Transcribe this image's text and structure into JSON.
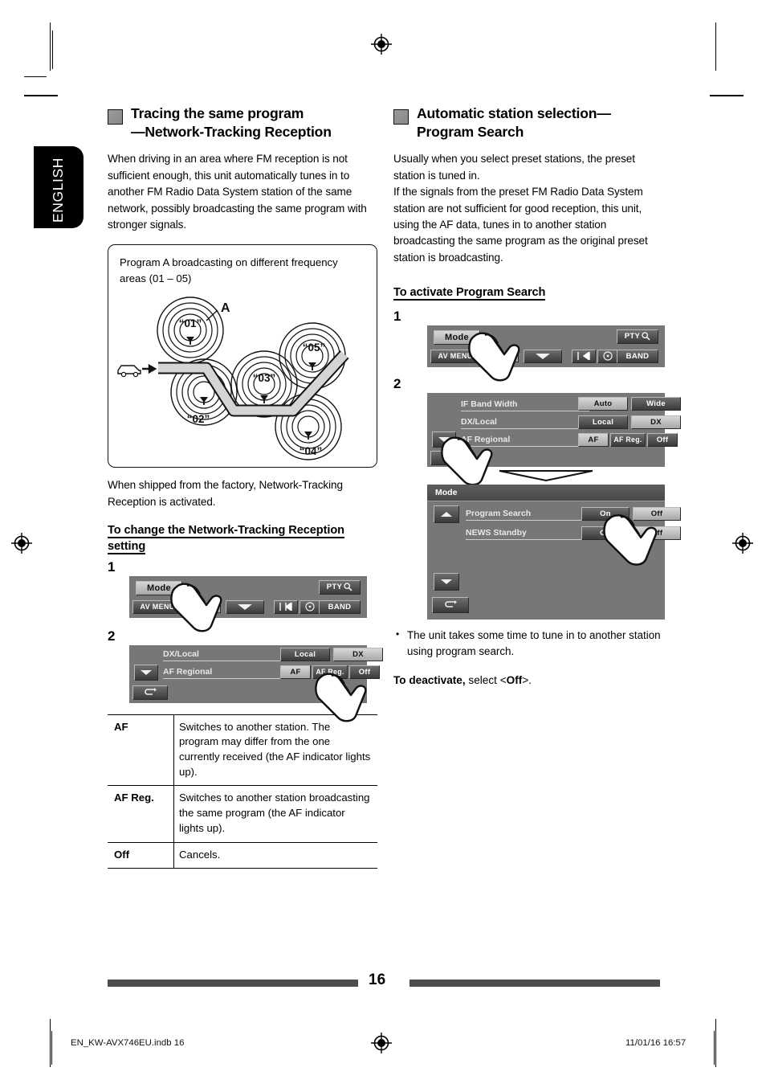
{
  "page": {
    "language_tab": "ENGLISH",
    "number": "16",
    "footer_left": "EN_KW-AVX746EU.indb   16",
    "footer_right": "11/01/16   16:57"
  },
  "left_column": {
    "heading": "Tracing the same program —Network-Tracking Reception",
    "heading_line1": "Tracing the same program",
    "heading_line2": "—Network-Tracking Reception",
    "intro": "When driving in an area where FM reception is not sufficient enough, this unit automatically tunes in to another FM Radio Data System station of the same network, possibly broadcasting the same program with stronger signals.",
    "diagram": {
      "caption": "Program A broadcasting on different frequency areas (01 – 05)",
      "label_a": "A",
      "zones": [
        "“01”",
        "“02”",
        "“03”",
        "“04”",
        "“05”"
      ]
    },
    "after_diagram": "When shipped from the factory, Network-Tracking Reception is activated.",
    "subheading": "To change the Network-Tracking Reception setting",
    "step1_label": "1",
    "step2_label": "2",
    "screen1": {
      "mode": "Mode",
      "av_menu": "AV MENU",
      "preset": "P",
      "pty": "PTY",
      "band": "BAND",
      "icons": [
        "down-arrow-icon",
        "prev-track-icon",
        "disc-icon",
        "next-track-icon",
        "magnifier-icon"
      ]
    },
    "screen2": {
      "rows": [
        {
          "label": "DX/Local",
          "options": [
            "Local",
            "DX"
          ],
          "selected": "DX"
        },
        {
          "label": "AF Regional",
          "options": [
            "AF",
            "AF Reg.",
            "Off"
          ],
          "selected": "AF"
        }
      ],
      "nav": [
        "scroll-down-icon",
        "return-icon"
      ]
    },
    "table": {
      "rows": [
        {
          "key": "AF",
          "desc": "Switches to another station. The program may differ from the one currently received (the AF indicator lights up)."
        },
        {
          "key": "AF Reg.",
          "desc": "Switches to another station broadcasting the same program (the AF indicator lights up)."
        },
        {
          "key": "Off",
          "desc": "Cancels."
        }
      ]
    }
  },
  "right_column": {
    "heading_line1": "Automatic station selection—",
    "heading_line2": "Program Search",
    "intro_p1": "Usually when you select preset stations, the preset station is tuned in.",
    "intro_p2": "If the signals from the preset FM Radio Data System station are not sufficient for good reception, this unit, using the AF data, tunes in to another station broadcasting the same program as the original preset station is broadcasting.",
    "subheading": "To activate Program Search",
    "step1_label": "1",
    "step2_label": "2",
    "screen1": {
      "mode": "Mode",
      "av_menu": "AV MENU",
      "preset": "P",
      "pty": "PTY",
      "band": "BAND"
    },
    "screen2": {
      "rows": [
        {
          "label": "IF Band Width",
          "options": [
            "Auto",
            "Wide"
          ],
          "selected": "Auto"
        },
        {
          "label": "DX/Local",
          "options": [
            "Local",
            "DX"
          ],
          "selected": "DX"
        },
        {
          "label": "AF Regional",
          "options": [
            "AF",
            "AF Reg.",
            "Off"
          ],
          "selected": "AF"
        }
      ],
      "nav": [
        "scroll-down-icon",
        "return-icon"
      ]
    },
    "screen3": {
      "title": "Mode",
      "rows": [
        {
          "label": "Program Search",
          "options": [
            "On",
            "Off"
          ],
          "selected": "On"
        },
        {
          "label": "NEWS Standby",
          "options": [
            "On",
            "Off"
          ],
          "selected": "Off"
        }
      ],
      "nav": [
        "scroll-up-icon",
        "scroll-down-icon",
        "return-icon"
      ]
    },
    "note": "The unit takes some time to tune in to another station using program search.",
    "deactivate_bold": "To deactivate,",
    "deactivate_rest": " select <",
    "deactivate_off": "Off",
    "deactivate_end": ">."
  },
  "colors": {
    "panel_bg": "#777777",
    "panel_title": "#4f4f4f",
    "btn_dark": "#1a1a1a",
    "btn_light": "#c4c4c4",
    "rule": "#4d4d4d"
  }
}
